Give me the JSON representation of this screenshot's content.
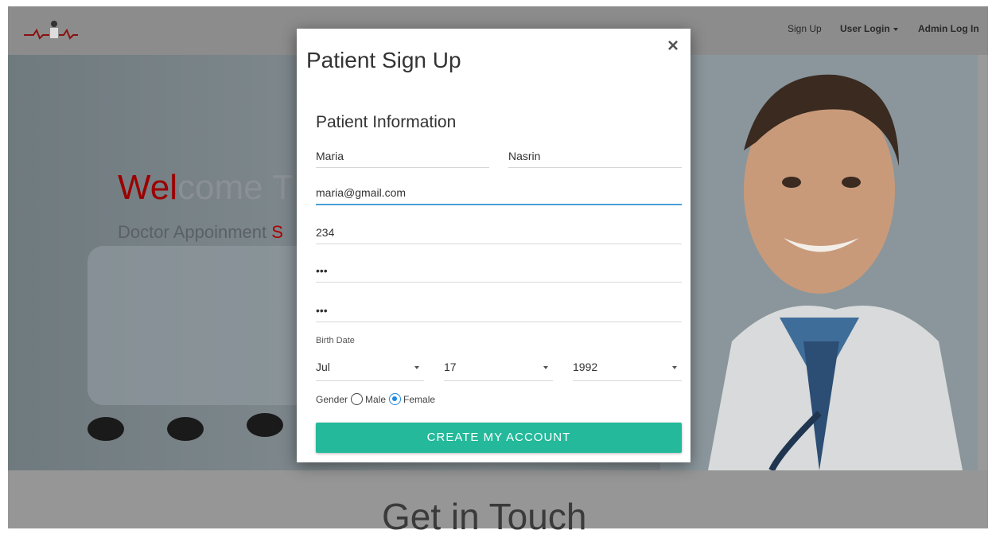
{
  "nav": {
    "signup": "Sign Up",
    "user_login": "User Login",
    "admin_login": "Admin Log In"
  },
  "hero": {
    "title_red": "Wel",
    "title_rest": "come T",
    "subtitle_gray": "Doctor Appoinment ",
    "subtitle_red": "S"
  },
  "bottom": {
    "title": "Get in Touch"
  },
  "modal": {
    "title": "Patient Sign Up",
    "close": "×",
    "section": "Patient Information",
    "first_name": "Maria",
    "last_name": "Nasrin",
    "email": "maria@gmail.com",
    "phone": "234",
    "password": "•••",
    "confirm_password": "•••",
    "birth_label": "Birth Date",
    "month": "Jul",
    "day": "17",
    "year": "1992",
    "gender_label": "Gender",
    "male": "Male",
    "female": "Female",
    "gender_selected": "Female",
    "submit": "CREATE MY ACCOUNT"
  },
  "colors": {
    "accent": "#23b99a",
    "focus": "#4a9fd8",
    "radio": "#1e88e5",
    "brand_red": "#9b0000"
  }
}
